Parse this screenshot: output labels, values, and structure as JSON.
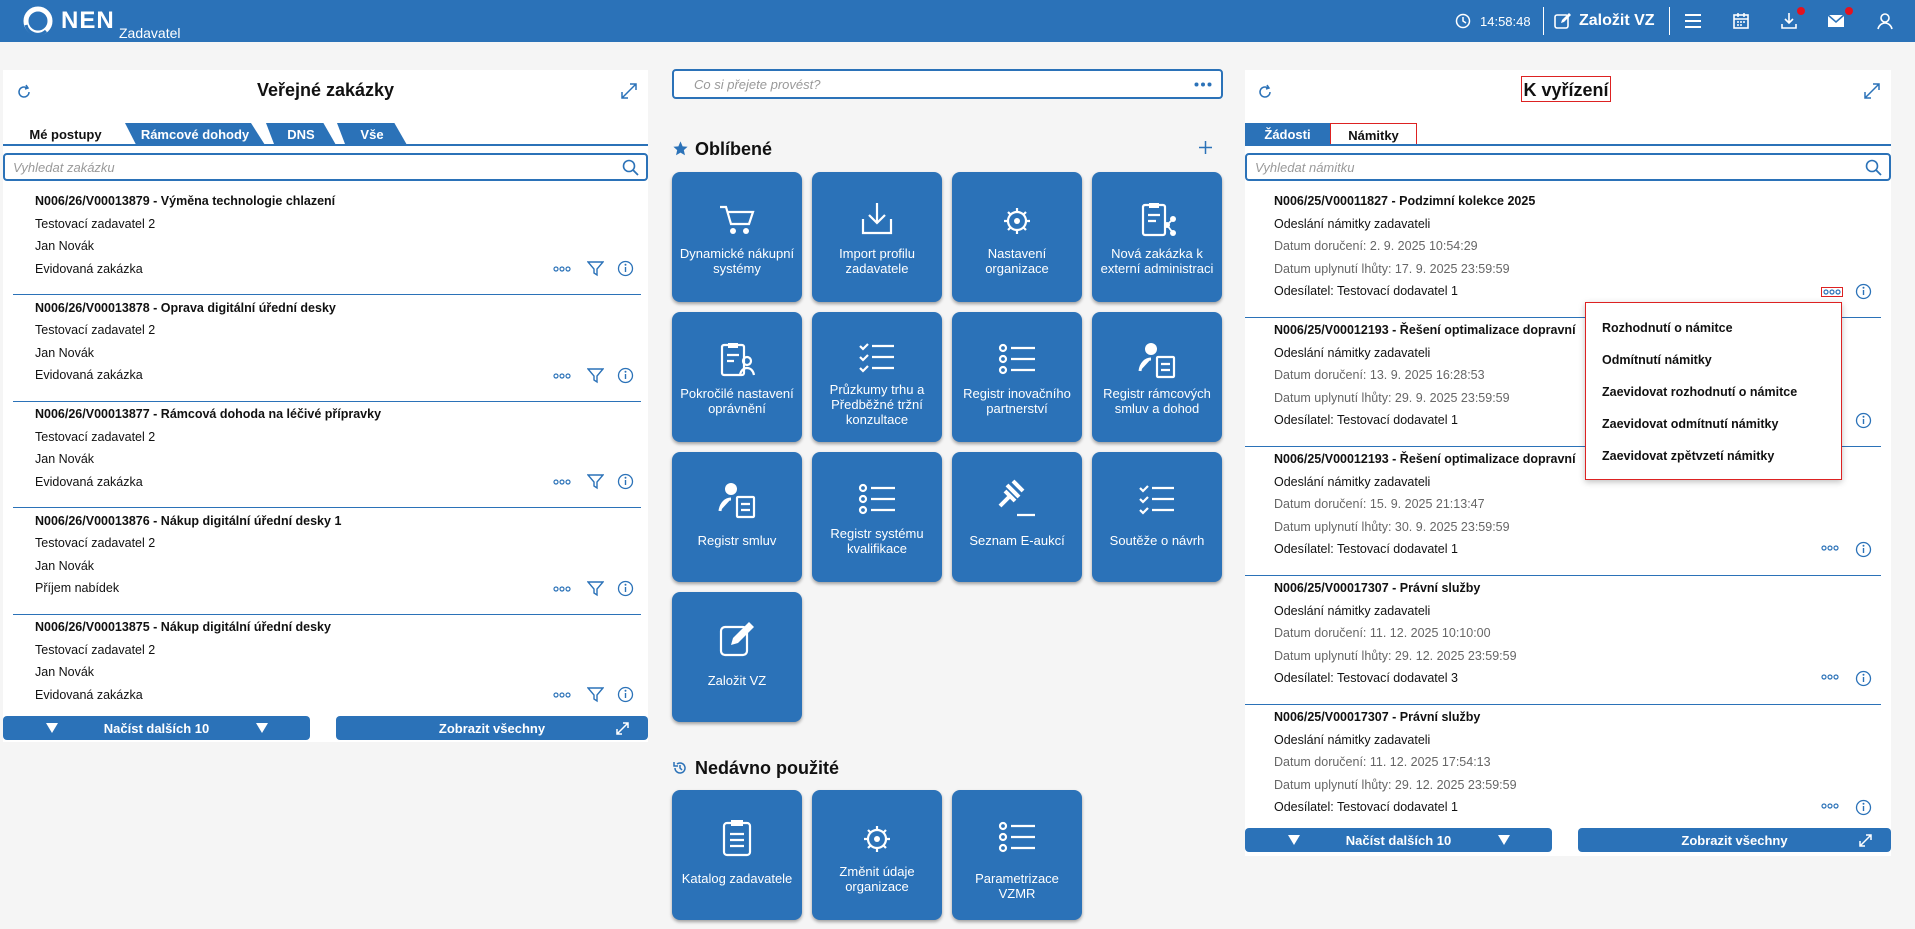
{
  "header": {
    "brand": "NEN",
    "subtitle": "Zadavatel",
    "time": "14:58:48",
    "new_label": "Založit VZ",
    "icons": [
      "clock-icon",
      "edit-icon",
      "menu-icon",
      "calendar-icon",
      "download-icon",
      "mail-icon",
      "user-icon"
    ],
    "accent": "#2b72b8",
    "alert": "#e3131f"
  },
  "left": {
    "title": "Veřejné zakázky",
    "tabs": [
      "Mé postupy",
      "Rámcové dohody",
      "DNS",
      "Vše"
    ],
    "active_tab": 0,
    "search_placeholder": "Vyhledat zakázku",
    "items": [
      {
        "title": "N006/26/V00013879 - Výměna technologie chlazení",
        "org": "Testovací zadavatel 2",
        "person": "Jan Novák",
        "status": "Evidovaná zakázka"
      },
      {
        "title": "N006/26/V00013878 - Oprava digitální úřední desky",
        "org": "Testovací zadavatel 2",
        "person": "Jan Novák",
        "status": "Evidovaná zakázka"
      },
      {
        "title": "N006/26/V00013877 - Rámcová dohoda na léčivé přípravky",
        "org": "Testovací zadavatel 2",
        "person": "Jan Novák",
        "status": "Evidovaná zakázka"
      },
      {
        "title": "N006/26/V00013876 - Nákup digitální úřední desky 1",
        "org": "Testovací zadavatel 2",
        "person": "Jan Novák",
        "status": "Příjem nabídek"
      },
      {
        "title": "N006/26/V00013875 - Nákup digitální úřední desky",
        "org": "Testovací zadavatel 2",
        "person": "Jan Novák",
        "status": "Evidovaná zakázka"
      }
    ],
    "load_more": "Načíst dalších 10",
    "show_all": "Zobrazit všechny"
  },
  "center": {
    "command_placeholder": "Co si přejete provést?",
    "favorites_title": "Oblíbené",
    "favorites": [
      {
        "label": "Dynamické nákupní systémy",
        "icon": "cart-icon"
      },
      {
        "label": "Import profilu zadavatele",
        "icon": "import-icon"
      },
      {
        "label": "Nastavení organizace",
        "icon": "org-settings-icon"
      },
      {
        "label": "Nová zakázka k externí administraci",
        "icon": "clipboard-share-icon"
      },
      {
        "label": "Pokročilé nastavení oprávnění",
        "icon": "clipboard-user-icon"
      },
      {
        "label": "Průzkumy trhu a Předběžné tržní konzultace",
        "icon": "checklist-icon"
      },
      {
        "label": "Registr inovačního partnerství",
        "icon": "list-icon"
      },
      {
        "label": "Registr rámcových smluv a dohod",
        "icon": "user-document-icon"
      },
      {
        "label": "Registr smluv",
        "icon": "user-document-icon"
      },
      {
        "label": "Registr systému kvalifikace",
        "icon": "list-icon"
      },
      {
        "label": "Seznam E-aukcí",
        "icon": "gavel-icon"
      },
      {
        "label": "Soutěže o návrh",
        "icon": "checklist-icon"
      },
      {
        "label": "Založit VZ",
        "icon": "edit-icon"
      }
    ],
    "recent_title": "Nedávno použité",
    "recent": [
      {
        "label": "Katalog zadavatele",
        "icon": "clipboard-list-icon"
      },
      {
        "label": "Změnit údaje organizace",
        "icon": "org-settings-icon"
      },
      {
        "label": "Parametrizace VZMR",
        "icon": "list-icon"
      }
    ]
  },
  "right": {
    "title": "K vyřízení",
    "tabs": [
      "Žádosti",
      "Námitky"
    ],
    "active_tab": 1,
    "search_placeholder": "Vyhledat námitku",
    "items": [
      {
        "title": "N006/25/V00011827 - Podzimní kolekce 2025",
        "type": "Odeslání námitky zadavateli",
        "delivered": "Datum doručení: 2. 9. 2025 10:54:29",
        "deadline": "Datum uplynutí lhůty: 17. 9. 2025 23:59:59",
        "sender": "Odesílatel: Testovací dodavatel 1"
      },
      {
        "title": "N006/25/V00012193 - Řešení optimalizace dopravní",
        "type": "Odeslání námitky zadavateli",
        "delivered": "Datum doručení: 13. 9. 2025 16:28:53",
        "deadline": "Datum uplynutí lhůty: 29. 9. 2025 23:59:59",
        "sender": "Odesílatel: Testovací dodavatel 1"
      },
      {
        "title": "N006/25/V00012193 - Řešení optimalizace dopravní",
        "type": "Odeslání námitky zadavateli",
        "delivered": "Datum doručení: 15. 9. 2025 21:13:47",
        "deadline": "Datum uplynutí lhůty: 30. 9. 2025 23:59:59",
        "sender": "Odesílatel: Testovací dodavatel 1"
      },
      {
        "title": "N006/25/V00017307 - Právní služby",
        "type": "Odeslání námitky zadavateli",
        "delivered": "Datum doručení: 11. 12. 2025 10:10:00",
        "deadline": "Datum uplynutí lhůty: 29. 12. 2025 23:59:59",
        "sender": "Odesílatel: Testovací dodavatel 3"
      },
      {
        "title": "N006/25/V00017307 - Právní služby",
        "type": "Odeslání námitky zadavateli",
        "delivered": "Datum doručení: 11. 12. 2025 17:54:13",
        "deadline": "Datum uplynutí lhůty: 29. 12. 2025 23:59:59",
        "sender": "Odesílatel: Testovací dodavatel 1"
      }
    ],
    "load_more": "Načíst dalších 10",
    "show_all": "Zobrazit všechny",
    "context_menu": [
      "Rozhodnutí o námitce",
      "Odmítnutí námitky",
      "Zaevidovat rozhodnutí o námitce",
      "Zaevidovat odmítnutí námitky",
      "Zaevidovat zpětvzetí námitky"
    ]
  }
}
